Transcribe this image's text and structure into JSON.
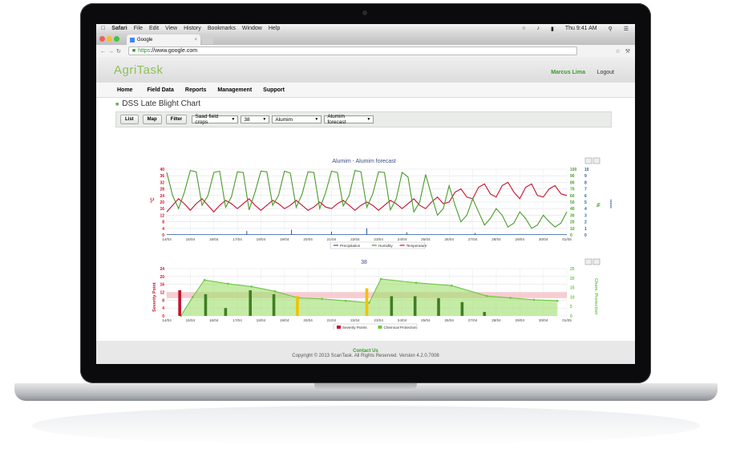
{
  "menubar": {
    "app": "Safari",
    "items": [
      "File",
      "Edit",
      "View",
      "History",
      "Bookmarks",
      "Window",
      "Help"
    ],
    "clock": "Thu 9:41 AM"
  },
  "browser": {
    "tab_title": "Google",
    "url_scheme": "https",
    "url_host": "://www.google.com"
  },
  "app": {
    "logo": "AgriTask",
    "user": "Marcus Lima",
    "logout": "Logout",
    "nav": [
      "Home",
      "Field Data",
      "Reports",
      "Management",
      "Support"
    ],
    "page_title": "DSS Late Blight Chart",
    "toolbar": {
      "buttons": [
        "List",
        "Map",
        "Filter"
      ],
      "selects": [
        "Saad field crops",
        "38",
        "Alumim",
        "Alumim forecast"
      ]
    }
  },
  "chart_data": [
    {
      "type": "line",
      "title": "Alumim - Alumim forecast",
      "categories": [
        "14/04",
        "15/04",
        "16/04",
        "17/04",
        "18/04",
        "19/04",
        "20/04",
        "21/04",
        "22/04",
        "23/04",
        "24/04",
        "25/04",
        "26/04",
        "27/04",
        "28/04",
        "29/04",
        "30/04",
        "01/05"
      ],
      "y_left": {
        "label": "°C",
        "ticks": [
          0,
          4,
          8,
          12,
          16,
          20,
          24,
          28,
          32,
          36,
          40
        ],
        "range": [
          0,
          40
        ]
      },
      "y_right_humidity": {
        "label": "%",
        "ticks": [
          0,
          10,
          20,
          30,
          40,
          50,
          60,
          70,
          80,
          90,
          100
        ],
        "range": [
          0,
          100
        ]
      },
      "y_right_rain": {
        "label": "mm",
        "ticks": [
          0,
          1,
          2,
          3,
          4,
          5,
          6,
          7,
          8,
          9,
          10
        ],
        "range": [
          0,
          10
        ]
      },
      "legend": [
        "Precipitation",
        "Humidity",
        "Temperature"
      ],
      "series": [
        {
          "name": "Temperature",
          "color": "#c8102e",
          "axis": "left",
          "x": [
            0,
            0.25,
            0.5,
            0.75,
            1,
            1.25,
            1.5,
            1.75,
            2,
            2.25,
            2.5,
            2.75,
            3,
            3.25,
            3.5,
            3.75,
            4,
            4.25,
            4.5,
            4.75,
            5,
            5.25,
            5.5,
            5.75,
            6,
            6.25,
            6.5,
            6.75,
            7,
            7.25,
            7.5,
            7.75,
            8,
            8.25,
            8.5,
            8.75,
            9,
            9.25,
            9.5,
            9.75,
            10,
            10.25,
            10.5,
            10.75,
            11,
            11.25,
            11.5,
            11.75,
            12,
            12.25,
            12.5,
            12.75,
            13,
            13.25,
            13.5,
            13.75,
            14,
            14.25,
            14.5,
            14.75,
            15,
            15.25,
            15.5,
            15.75,
            16,
            16.25,
            16.5,
            16.75,
            17
          ],
          "values": [
            14,
            18,
            22,
            19,
            15,
            19,
            22,
            18,
            14,
            18,
            21,
            19,
            16,
            19,
            22,
            18,
            15,
            18,
            21,
            19,
            16,
            18,
            21,
            18,
            15,
            17,
            20,
            17,
            16,
            19,
            21,
            18,
            15,
            18,
            20,
            18,
            15,
            18,
            21,
            19,
            16,
            19,
            22,
            18,
            16,
            20,
            23,
            19,
            20,
            26,
            28,
            23,
            22,
            29,
            31,
            25,
            23,
            30,
            32,
            26,
            22,
            29,
            31,
            24,
            23,
            28,
            30,
            25,
            24
          ]
        },
        {
          "name": "Humidity",
          "color": "#4a9a2a",
          "axis": "right",
          "x": [
            0,
            0.25,
            0.5,
            0.75,
            1,
            1.25,
            1.5,
            1.75,
            2,
            2.25,
            2.5,
            2.75,
            3,
            3.25,
            3.5,
            3.75,
            4,
            4.25,
            4.5,
            4.75,
            5,
            5.25,
            5.5,
            5.75,
            6,
            6.25,
            6.5,
            6.75,
            7,
            7.25,
            7.5,
            7.75,
            8,
            8.25,
            8.5,
            8.75,
            9,
            9.25,
            9.5,
            9.75,
            10,
            10.25,
            10.5,
            10.75,
            11,
            11.25,
            11.5,
            11.75,
            12,
            12.25,
            12.5,
            12.75,
            13,
            13.25,
            13.5,
            13.75,
            14,
            14.25,
            14.5,
            14.75,
            15,
            15.25,
            15.5,
            15.75,
            16,
            16.25,
            16.5,
            16.75,
            17
          ],
          "values": [
            95,
            60,
            40,
            65,
            98,
            96,
            45,
            60,
            95,
            97,
            42,
            58,
            96,
            95,
            38,
            65,
            97,
            96,
            45,
            60,
            97,
            94,
            42,
            62,
            96,
            95,
            40,
            64,
            97,
            95,
            44,
            60,
            98,
            96,
            42,
            62,
            96,
            95,
            38,
            55,
            95,
            88,
            35,
            50,
            92,
            60,
            30,
            40,
            75,
            45,
            20,
            30,
            55,
            35,
            15,
            25,
            40,
            30,
            12,
            18,
            35,
            25,
            10,
            15,
            30,
            20,
            12,
            18,
            35
          ]
        },
        {
          "name": "Precipitation",
          "color": "#2b5aa8",
          "axis": "rain",
          "x": [
            3.4,
            5.3,
            7.0,
            8.5,
            10.2,
            13.1
          ],
          "values": [
            0.6,
            0.8,
            0.5,
            1.0,
            0.4,
            0.3
          ]
        }
      ]
    },
    {
      "type": "bar",
      "title": "38",
      "categories": [
        "14/04",
        "15/04",
        "16/04",
        "17/04",
        "18/04",
        "19/04",
        "20/04",
        "21/04",
        "22/04",
        "23/04",
        "24/04",
        "25/04",
        "26/04",
        "27/04",
        "28/04",
        "29/04",
        "30/04",
        "01/05"
      ],
      "y_left": {
        "label": "Severity Point",
        "ticks": [
          0,
          4,
          8,
          12,
          16,
          20,
          24
        ],
        "range": [
          0,
          24
        ]
      },
      "y_right": {
        "label": "Chem. Protection",
        "ticks": [
          0,
          5,
          10,
          15,
          20,
          25
        ],
        "range": [
          0,
          25
        ]
      },
      "legend": [
        "Severity Points",
        "Chemical Protection"
      ],
      "severity_bars": [
        {
          "x": 0.55,
          "value": 13,
          "color": "#c8102e"
        },
        {
          "x": 1.65,
          "value": 11,
          "color": "#3f7f22"
        },
        {
          "x": 2.5,
          "value": 4,
          "color": "#3f7f22"
        },
        {
          "x": 3.55,
          "value": 13,
          "color": "#3f7f22"
        },
        {
          "x": 4.55,
          "value": 11,
          "color": "#3f7f22"
        },
        {
          "x": 5.55,
          "value": 10,
          "color": "#f2c200"
        },
        {
          "x": 8.5,
          "value": 14,
          "color": "#f2c200"
        },
        {
          "x": 9.55,
          "value": 10,
          "color": "#3f7f22"
        },
        {
          "x": 10.55,
          "value": 10,
          "color": "#3f7f22"
        },
        {
          "x": 11.55,
          "value": 9,
          "color": "#3f7f22"
        },
        {
          "x": 12.55,
          "value": 7,
          "color": "#3f7f22"
        },
        {
          "x": 13.5,
          "value": 2,
          "color": "#3f7f22"
        }
      ],
      "chemical_protection": {
        "x": [
          0.6,
          1.1,
          1.6,
          2.6,
          3.6,
          4.6,
          5.6,
          6.6,
          7.6,
          8.6,
          9.1,
          10.6,
          12.1,
          13.6,
          14.6,
          15.6,
          16.6
        ],
        "values": [
          0,
          10,
          19,
          17,
          15.5,
          13,
          9.5,
          9,
          8,
          7,
          19.5,
          17.5,
          16,
          10.5,
          9.5,
          8.5,
          8
        ]
      },
      "band": {
        "y0": 9,
        "y1": 12,
        "color": "#f6b6bf"
      }
    }
  ],
  "footer": {
    "contact": "Contact Us",
    "copyright": "Copyright © 2013 ScanTask. All Rights Reserved. Version 4.2.0.7008"
  }
}
